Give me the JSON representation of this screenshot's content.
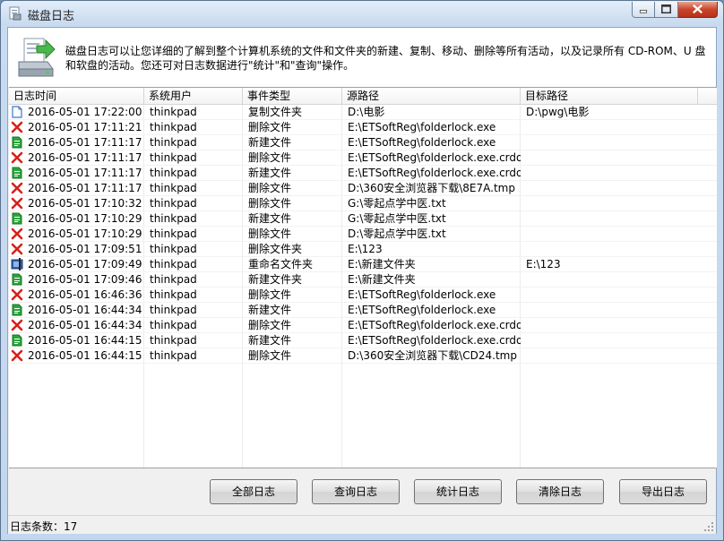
{
  "window": {
    "title": "磁盘日志"
  },
  "header": {
    "description": "磁盘日志可以让您详细的了解到整个计算机系统的文件和文件夹的新建、复制、移动、删除等所有活动，以及记录所有 CD-ROM、U 盘和软盘的活动。您还可对日志数据进行\"统计\"和\"查询\"操作。"
  },
  "table": {
    "columns": [
      "日志时间",
      "系统用户",
      "事件类型",
      "源路径",
      "目标路径"
    ],
    "rows": [
      {
        "icon": "copy-icon",
        "time": "2016-05-01 17:22:00",
        "user": "thinkpad",
        "event": "复制文件夹",
        "source": "D:\\电影",
        "target": "D:\\pwg\\电影"
      },
      {
        "icon": "delete-icon",
        "time": "2016-05-01 17:11:21",
        "user": "thinkpad",
        "event": "删除文件",
        "source": "E:\\ETSoftReg\\folderlock.exe",
        "target": ""
      },
      {
        "icon": "new-icon",
        "time": "2016-05-01 17:11:17",
        "user": "thinkpad",
        "event": "新建文件",
        "source": "E:\\ETSoftReg\\folderlock.exe",
        "target": ""
      },
      {
        "icon": "delete-icon",
        "time": "2016-05-01 17:11:17",
        "user": "thinkpad",
        "event": "删除文件",
        "source": "E:\\ETSoftReg\\folderlock.exe.crdo...",
        "target": ""
      },
      {
        "icon": "new-icon",
        "time": "2016-05-01 17:11:17",
        "user": "thinkpad",
        "event": "新建文件",
        "source": "E:\\ETSoftReg\\folderlock.exe.crdo...",
        "target": ""
      },
      {
        "icon": "delete-icon",
        "time": "2016-05-01 17:11:17",
        "user": "thinkpad",
        "event": "删除文件",
        "source": "D:\\360安全浏览器下载\\8E7A.tmp",
        "target": ""
      },
      {
        "icon": "delete-icon",
        "time": "2016-05-01 17:10:32",
        "user": "thinkpad",
        "event": "删除文件",
        "source": "G:\\零起点学中医.txt",
        "target": ""
      },
      {
        "icon": "new-icon",
        "time": "2016-05-01 17:10:29",
        "user": "thinkpad",
        "event": "新建文件",
        "source": "G:\\零起点学中医.txt",
        "target": ""
      },
      {
        "icon": "delete-icon",
        "time": "2016-05-01 17:10:29",
        "user": "thinkpad",
        "event": "删除文件",
        "source": "D:\\零起点学中医.txt",
        "target": ""
      },
      {
        "icon": "delete-icon",
        "time": "2016-05-01 17:09:51",
        "user": "thinkpad",
        "event": "删除文件夹",
        "source": "E:\\123",
        "target": ""
      },
      {
        "icon": "rename-icon",
        "time": "2016-05-01 17:09:49",
        "user": "thinkpad",
        "event": "重命名文件夹",
        "source": "E:\\新建文件夹",
        "target": "E:\\123"
      },
      {
        "icon": "new-icon",
        "time": "2016-05-01 17:09:46",
        "user": "thinkpad",
        "event": "新建文件夹",
        "source": "E:\\新建文件夹",
        "target": ""
      },
      {
        "icon": "delete-icon",
        "time": "2016-05-01 16:46:36",
        "user": "thinkpad",
        "event": "删除文件",
        "source": "E:\\ETSoftReg\\folderlock.exe",
        "target": ""
      },
      {
        "icon": "new-icon",
        "time": "2016-05-01 16:44:34",
        "user": "thinkpad",
        "event": "新建文件",
        "source": "E:\\ETSoftReg\\folderlock.exe",
        "target": ""
      },
      {
        "icon": "delete-icon",
        "time": "2016-05-01 16:44:34",
        "user": "thinkpad",
        "event": "删除文件",
        "source": "E:\\ETSoftReg\\folderlock.exe.crdo...",
        "target": ""
      },
      {
        "icon": "new-icon",
        "time": "2016-05-01 16:44:15",
        "user": "thinkpad",
        "event": "新建文件",
        "source": "E:\\ETSoftReg\\folderlock.exe.crdo...",
        "target": ""
      },
      {
        "icon": "delete-icon",
        "time": "2016-05-01 16:44:15",
        "user": "thinkpad",
        "event": "删除文件",
        "source": "D:\\360安全浏览器下载\\CD24.tmp",
        "target": ""
      }
    ]
  },
  "buttons": {
    "all_logs": "全部日志",
    "query_logs": "查询日志",
    "stats_logs": "统计日志",
    "clear_logs": "清除日志",
    "export_logs": "导出日志"
  },
  "status": {
    "count_label": "日志条数：17"
  },
  "colors": {
    "delete": "#d8201a",
    "new": "#2ca53c",
    "copy": "#3d78c7"
  }
}
